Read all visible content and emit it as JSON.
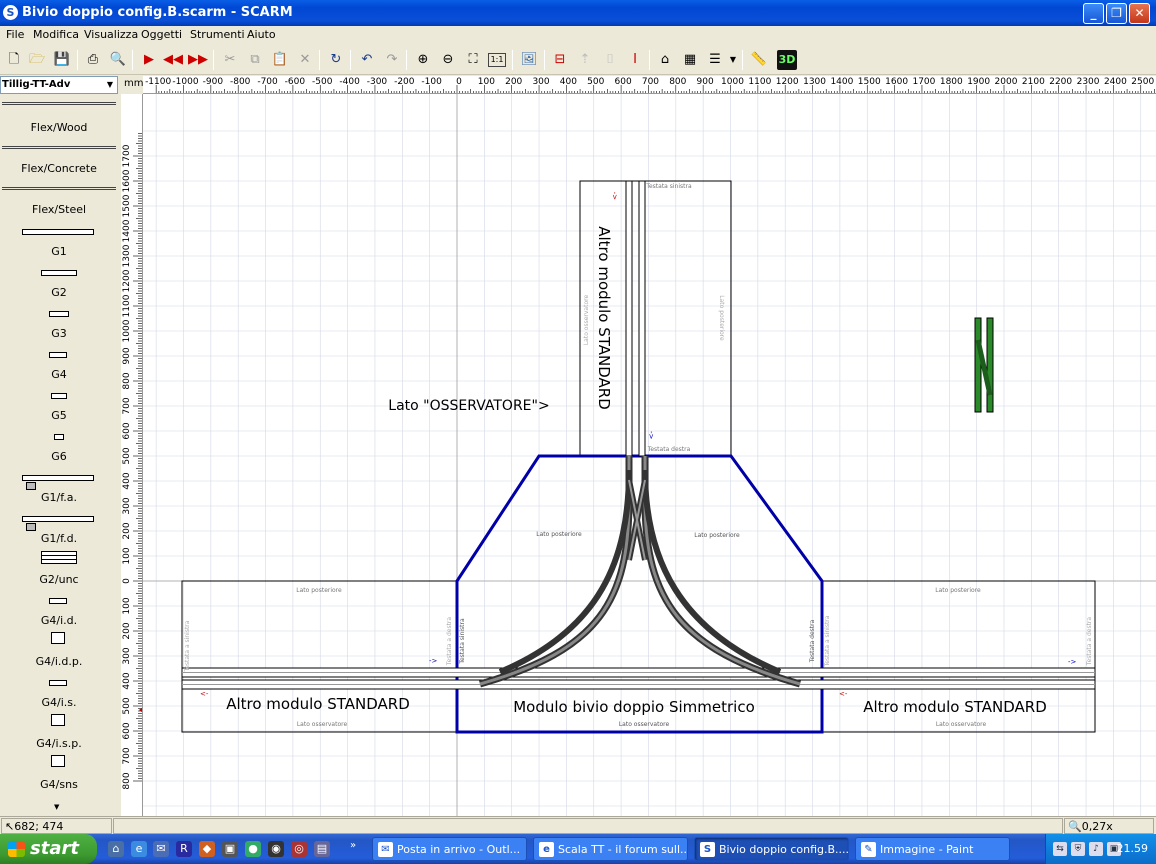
{
  "window": {
    "title": "Bivio doppio config.B.scarm - SCARM"
  },
  "menu": [
    "File",
    "Modifica",
    "Visualizza",
    "Oggetti",
    "Strumenti",
    "Aiuto"
  ],
  "toolbar": {
    "three_d_label": "3D",
    "scale_label": "1:1"
  },
  "library": {
    "selected": "Tillig-TT-Adv",
    "categories": [
      "Flex/Wood",
      "Flex/Concrete",
      "Flex/Steel"
    ],
    "items": [
      "G1",
      "G2",
      "G3",
      "G4",
      "G5",
      "G6",
      "G1/f.a.",
      "G1/f.d.",
      "G2/unc",
      "G4/i.d.",
      "G4/i.d.p.",
      "G4/i.s.",
      "G4/i.s.p.",
      "G4/sns"
    ]
  },
  "ruler": {
    "unit": "mm",
    "h_labels": [
      "-1100",
      "-1000",
      "-900",
      "-800",
      "-700",
      "-600",
      "-500",
      "-400",
      "-300",
      "-200",
      "-100",
      "0",
      "100",
      "200",
      "300",
      "400",
      "500",
      "600",
      "700",
      "800",
      "900",
      "1000",
      "1100",
      "1200",
      "1300",
      "1400",
      "1500",
      "1600",
      "1700",
      "1800",
      "1900",
      "2000",
      "2100",
      "2200",
      "2300",
      "2400",
      "2500"
    ],
    "v_labels": [
      "1700",
      "1600",
      "1500",
      "1400",
      "1300",
      "1200",
      "1100",
      "1000",
      "900",
      "800",
      "700",
      "600",
      "500",
      "400",
      "300",
      "200",
      "100",
      "0",
      "100",
      "200",
      "300",
      "400",
      "500",
      "600",
      "700",
      "800"
    ]
  },
  "canvas": {
    "module_left_label": "Altro modulo STANDARD",
    "module_center_label": "Modulo bivio doppio Simmetrico",
    "module_right_label": "Altro modulo STANDARD",
    "module_top_label": "Altro modulo STANDARD",
    "observer_label": "Lato \"OSSERVATORE\">",
    "small_lato_posteriore": "Lato posteriore",
    "small_lato_osservatore": "Lato osservatore",
    "small_testata_sinistra": "Testata sinistra",
    "small_testata_destra": "Testata destra",
    "small_testata_a_sinistra": "Testata a sinistra",
    "small_testata_a_destra": "Testata a destra",
    "arrow_right": "->",
    "arrow_left": "<-"
  },
  "status": {
    "coords": "682; 474",
    "zoom": "0,27x"
  },
  "taskbar": {
    "start": "start",
    "tasks": [
      "Posta in arrivo - Outl...",
      "Scala TT - il forum sull...",
      "Bivio doppio config.B....",
      "Immagine - Paint"
    ],
    "clock": "21.59",
    "overflow": "»"
  },
  "colors": {
    "module_outline": "#000000",
    "bivio_outline": "#0000a8",
    "track_fill": "#555555",
    "switch_green": "#2a8a2a",
    "grid": "#d4d8e6"
  }
}
